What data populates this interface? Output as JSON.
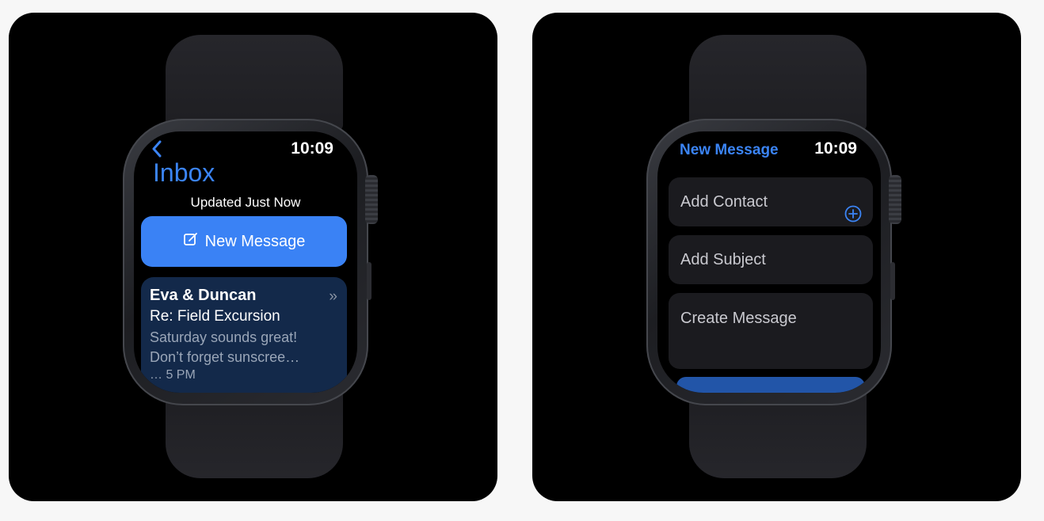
{
  "left_watch": {
    "time": "10:09",
    "title": "Inbox",
    "status": "Updated Just Now",
    "new_message_label": "New Message",
    "message": {
      "from": "Eva & Duncan",
      "subject": "Re: Field Excursion",
      "preview_line1": "Saturday sounds great!",
      "preview_line2": "Don’t forget sunscree…",
      "time_partial": "… 5 PM"
    }
  },
  "right_watch": {
    "title": "New Message",
    "time": "10:09",
    "fields": {
      "add_contact": "Add Contact",
      "add_subject": "Add Subject",
      "create_message": "Create Message"
    }
  },
  "colors": {
    "accent": "#3a82f5",
    "card": "#13294a",
    "field": "#1b1b1f",
    "background": "#000000"
  }
}
